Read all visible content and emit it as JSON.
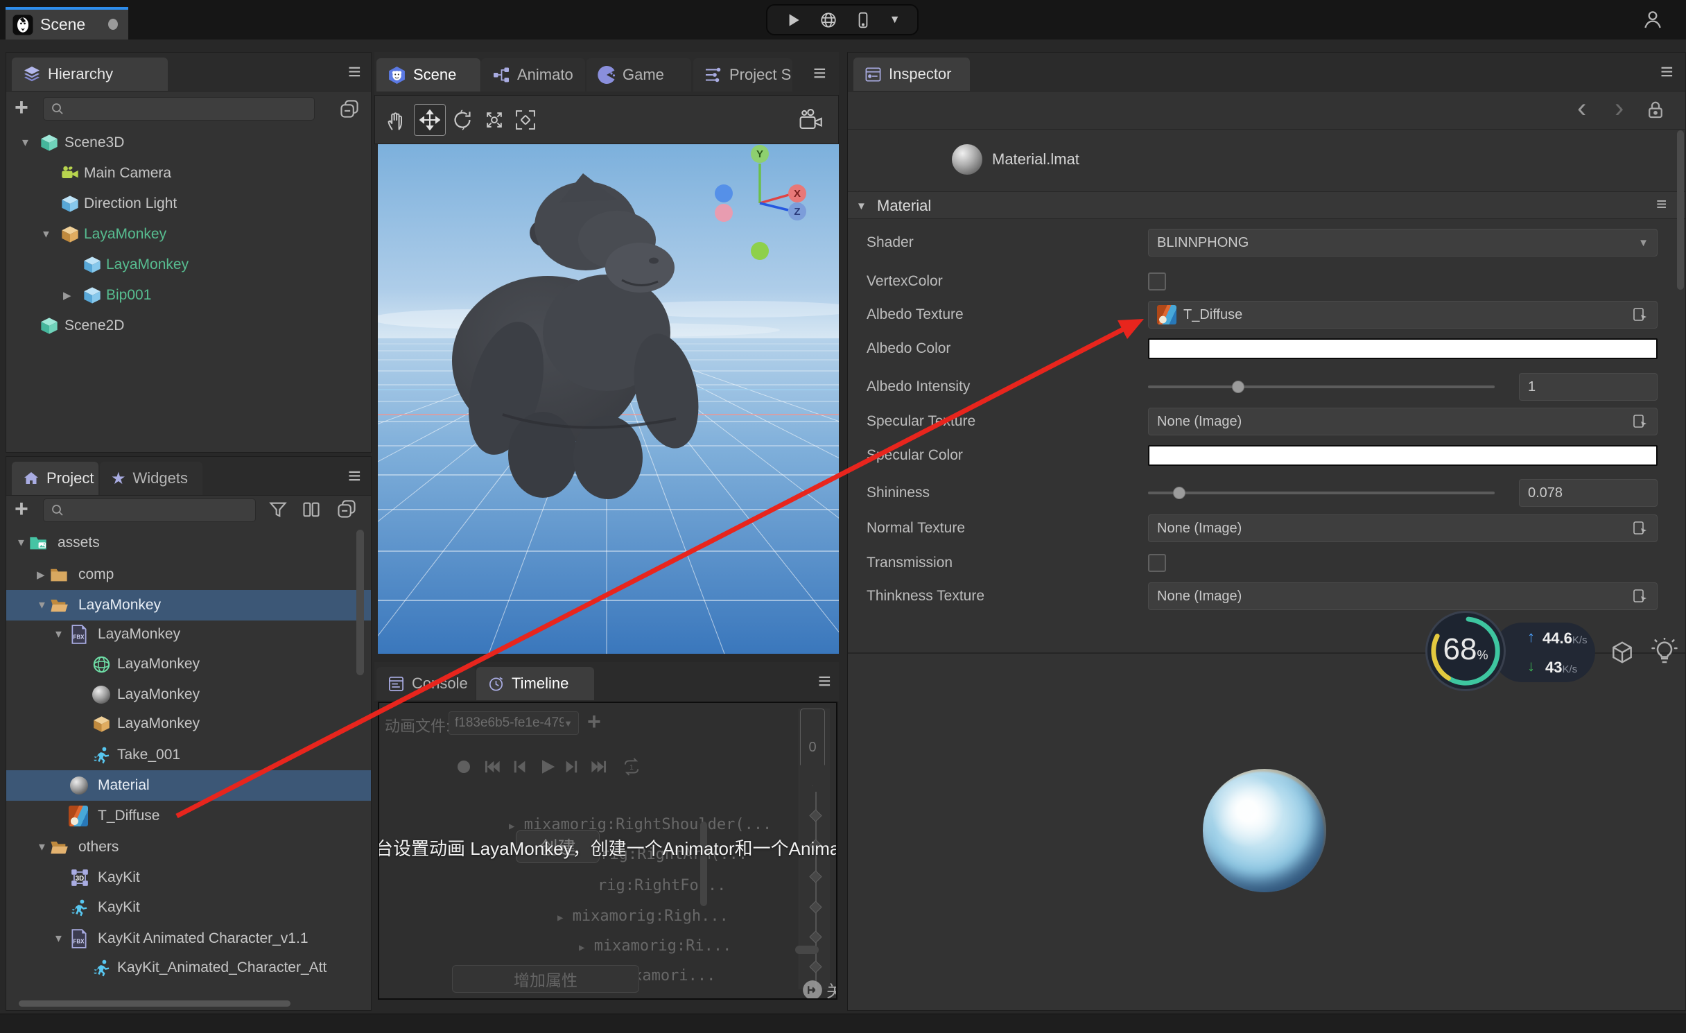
{
  "topbar": {
    "app_tab_label": "Scene"
  },
  "hierarchy": {
    "tab_label": "Hierarchy",
    "items": [
      "Scene3D",
      "Main Camera",
      "Direction Light",
      "LayaMonkey",
      "LayaMonkey",
      "Bip001",
      "Scene2D"
    ]
  },
  "project": {
    "tab_project_label": "Project",
    "tab_widgets_label": "Widgets",
    "items": [
      "assets",
      "comp",
      "LayaMonkey",
      "LayaMonkey",
      "LayaMonkey",
      "LayaMonkey",
      "LayaMonkey",
      "Take_001",
      "Material",
      "T_Diffuse",
      "others",
      "KayKit",
      "KayKit",
      "KayKit Animated Character_v1.1",
      "KayKit_Animated_Character_Att"
    ]
  },
  "scene_tabs": {
    "scene_label": "Scene",
    "animator_label": "Animato",
    "game_label": "Game",
    "project_settings_label": "Project S"
  },
  "scene_view": {
    "axis_x": "X",
    "axis_y": "Y",
    "axis_z": "Z"
  },
  "console_panel": {
    "tab_console_label": "Console",
    "tab_timeline_label": "Timeline",
    "anim_file_label": "动画文件:",
    "anim_file_value": "f183e6b5-fe1e-479",
    "loop_count": "1",
    "frame_number": "0",
    "tracks": [
      "mixamorig:RightShoulder(...",
      "mixamorig:RightArm(...",
      "rig:RightFo...",
      "mixamorig:Righ...",
      "mixamorig:Ri...",
      "mixamori..."
    ],
    "create_button_label": "创建",
    "add_property_button_label": "增加属性",
    "overlay_message": "台设置动画 LayaMonkey，创建一个Animator和一个Animation C",
    "close_label": "关"
  },
  "inspector": {
    "tab_label": "Inspector",
    "asset_title": "Material.lmat",
    "section_title": "Material",
    "shader_label": "Shader",
    "shader_value": "BLINNPHONG",
    "vertex_color_label": "VertexColor",
    "albedo_texture_label": "Albedo Texture",
    "albedo_texture_value": "T_Diffuse",
    "albedo_color_label": "Albedo Color",
    "albedo_intensity_label": "Albedo Intensity",
    "albedo_intensity_value": "1",
    "specular_texture_label": "Specular Texture",
    "specular_texture_value": "None (Image)",
    "specular_color_label": "Specular Color",
    "shininess_label": "Shininess",
    "shininess_value": "0.078",
    "normal_texture_label": "Normal Texture",
    "normal_texture_value": "None (Image)",
    "transmission_label": "Transmission",
    "thinkness_texture_label": "Thinkness Texture",
    "thinkness_texture_value": "None (Image)"
  },
  "stats_gauge": {
    "percent": "68",
    "percent_unit": "%",
    "upload_value": "44.6",
    "upload_unit": "K/s",
    "download_value": "43",
    "download_unit": "K/s"
  },
  "colors": {
    "accent_blue": "#2d8ceb",
    "selection_blue": "#3c5776",
    "tree_green": "#57bd90",
    "icon_purple": "#a9ace2",
    "arrow_red": "#e8251d",
    "gauge_teal": "#3ec6a0",
    "gauge_yellow": "#e3c93f",
    "sky_blue": "#7fb3dd"
  }
}
